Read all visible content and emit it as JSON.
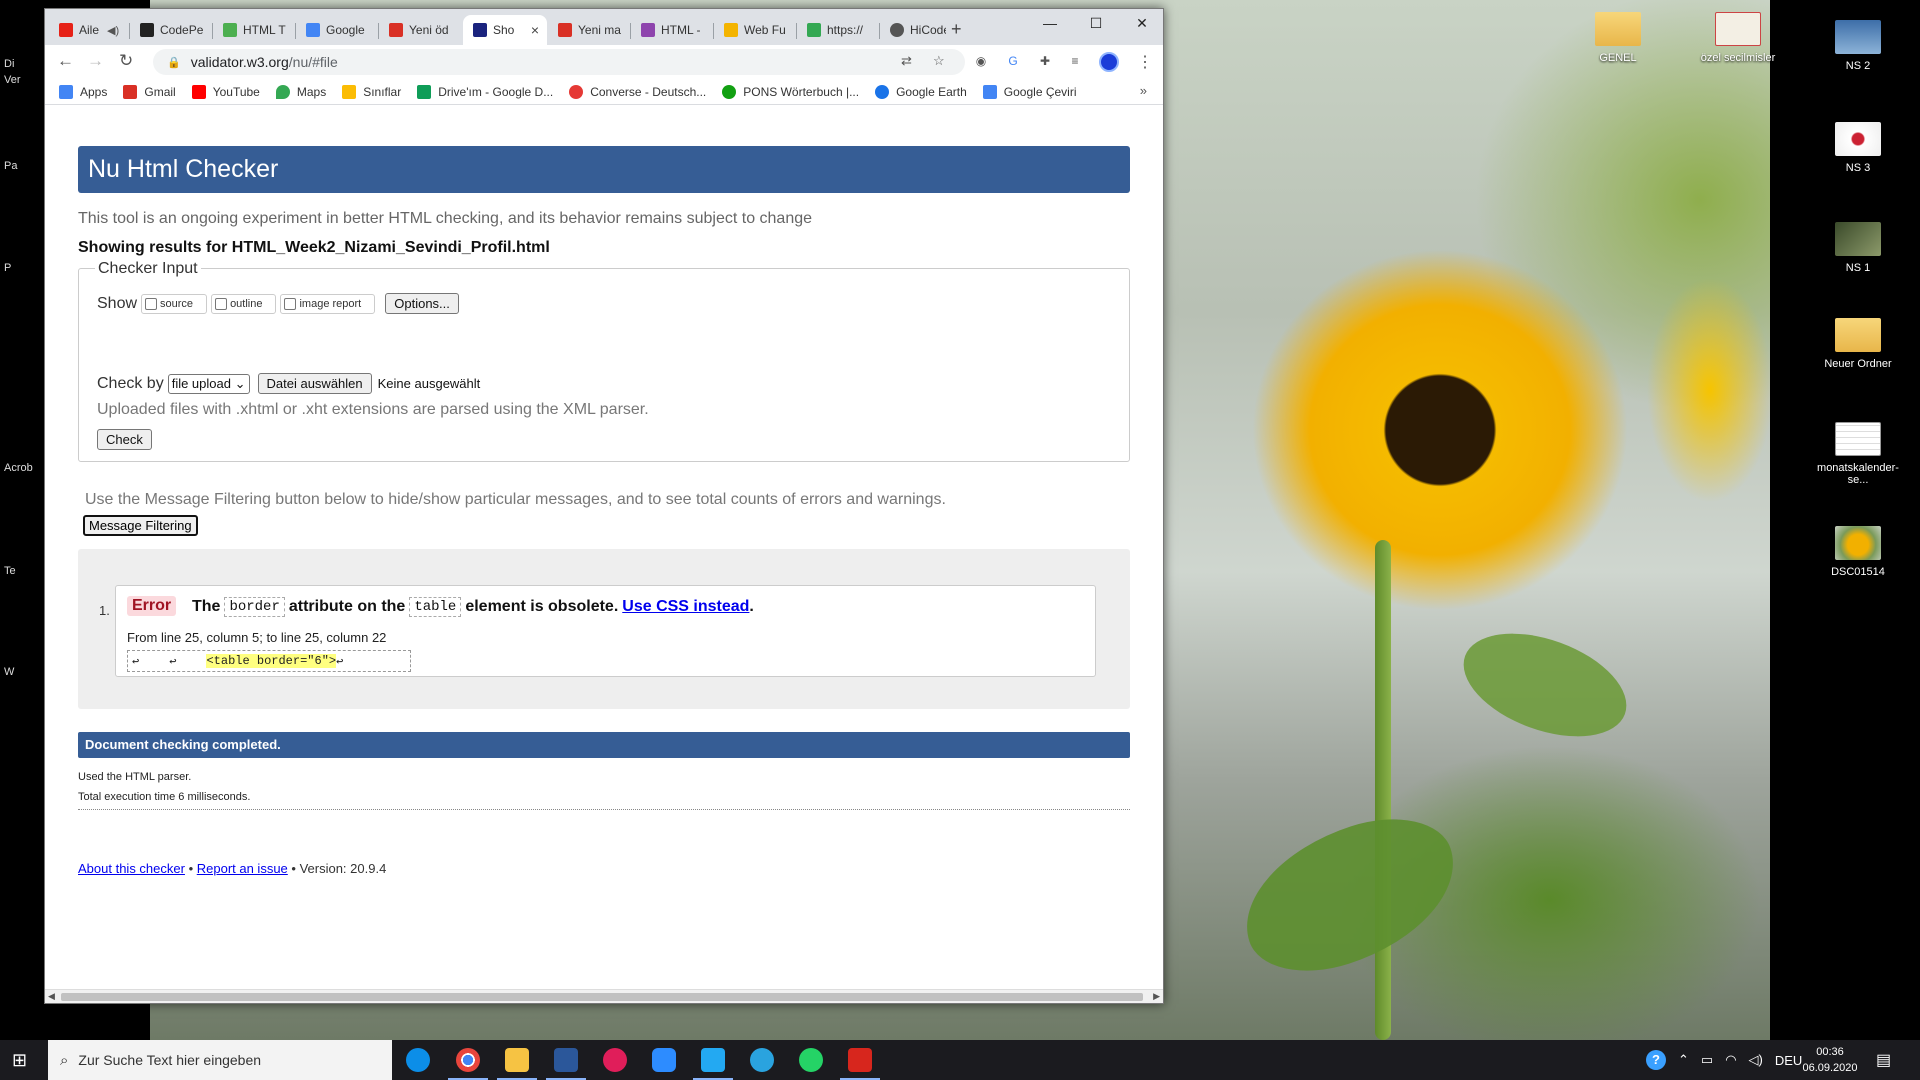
{
  "desktop": {
    "icons": [
      {
        "label": "GENEL",
        "thumb": "thumb-folder"
      },
      {
        "label": "özel secilmisler",
        "thumb": "thumb-pdf"
      },
      {
        "label": "NS 2",
        "thumb": "thumb-img1"
      },
      {
        "label": "NS 3",
        "thumb": "thumb-img2"
      },
      {
        "label": "NS 1",
        "thumb": "thumb-img3"
      },
      {
        "label": "Neuer Ordner",
        "thumb": "thumb-folder"
      },
      {
        "label": "monatskalender-se...",
        "thumb": "thumb-sheet"
      },
      {
        "label": "DSC01514",
        "thumb": "thumb-photo"
      }
    ],
    "left_fragments": [
      "Di",
      "Ver",
      "Pa",
      "P",
      "Acrob",
      "Te",
      "W"
    ]
  },
  "browser": {
    "tabs": [
      {
        "title": "Aile",
        "color": "#e62117"
      },
      {
        "title": "CodePe",
        "color": "#222222"
      },
      {
        "title": "HTML T",
        "color": "#4caf50"
      },
      {
        "title": "Google",
        "color": "#4285f4"
      },
      {
        "title": "Yeni öd",
        "color": "#d93025"
      },
      {
        "title": "Sho",
        "color": "#1a237e"
      },
      {
        "title": "Yeni ma",
        "color": "#d93025"
      },
      {
        "title": "HTML -",
        "color": "#8e44ad"
      },
      {
        "title": "Web Fu",
        "color": "#f4b400"
      },
      {
        "title": "https://",
        "color": "#34a853"
      },
      {
        "title": "HiCode",
        "color": "#555555"
      }
    ],
    "active_tab_index": 5,
    "tab_close_glyph": "×",
    "new_tab_glyph": "+",
    "window_controls": {
      "minimize": "—",
      "maximize": "☐",
      "close": "✕"
    },
    "nav": {
      "back": "←",
      "forward": "→",
      "reload": "↻"
    },
    "url": {
      "host": "validator.w3.org",
      "path": "/nu/#file"
    },
    "bookmarks": [
      {
        "label": "Apps",
        "color": "#4285f4"
      },
      {
        "label": "Gmail",
        "color": "#d93025"
      },
      {
        "label": "YouTube",
        "color": "#ff0000"
      },
      {
        "label": "Maps",
        "color": "#34a853"
      },
      {
        "label": "Sınıflar",
        "color": "#fbbc04"
      },
      {
        "label": "Drive'ım - Google D...",
        "color": "#0f9d58"
      },
      {
        "label": "Converse - Deutsch...",
        "color": "#e53935"
      },
      {
        "label": "PONS Wörterbuch |...",
        "color": "#12a012"
      },
      {
        "label": "Google Earth",
        "color": "#1a73e8"
      },
      {
        "label": "Google Çeviri",
        "color": "#4285f4"
      }
    ],
    "bookmarks_more": "»"
  },
  "page": {
    "header": "Nu Html Checker",
    "intro": "This tool is an ongoing experiment in better HTML checking, and its behavior remains subject to change",
    "results_prefix": "Showing results for ",
    "results_file": "HTML_Week2_Nizami_Sevindi_Profil.html",
    "checker_input_legend": "Checker Input",
    "show_label": "Show",
    "show_options": [
      "source",
      "outline",
      "image report"
    ],
    "options_button": "Options...",
    "check_by_label": "Check by",
    "check_by_value": "file upload",
    "file_button": "Datei auswählen",
    "no_file": "Keine ausgewählt",
    "xhtml_note": "Uploaded files with .xhtml or .xht extensions are parsed using the XML parser.",
    "check_button": "Check",
    "filter_note": "Use the Message Filtering button below to hide/show particular messages, and to see total counts of errors and warnings.",
    "filter_button": "Message Filtering",
    "message": {
      "number": "1.",
      "type": "Error",
      "text_the": "The",
      "attr": "border",
      "text_attr_on": "attribute on the",
      "element": "table",
      "text_obsolete": "element is obsolete.",
      "link": "Use CSS instead",
      "period": ".",
      "location": "From line 25, column 5; to line 25, column 22",
      "extract_lead": "↩",
      "extract_mid": "↩",
      "extract_code": "<table border=\"6\">",
      "extract_tail": "↩"
    },
    "completed": "Document checking completed.",
    "parser_line": "Used the HTML parser.",
    "exec_line": "Total execution time 6 milliseconds.",
    "footer": {
      "about": "About this checker",
      "sep1": " • ",
      "report": "Report an issue",
      "version": " • Version: 20.9.4"
    }
  },
  "taskbar": {
    "search_placeholder": "Zur Suche Text hier eingeben",
    "apps": [
      {
        "name": "edge",
        "color": "#0c8ee8"
      },
      {
        "name": "chrome",
        "color": "#e8453c"
      },
      {
        "name": "file-explorer",
        "color": "#f6c343"
      },
      {
        "name": "word",
        "color": "#2b579a"
      },
      {
        "name": "slack",
        "color": "#e01e5a"
      },
      {
        "name": "zoom",
        "color": "#2d8cff"
      },
      {
        "name": "vscode",
        "color": "#23a9f2"
      },
      {
        "name": "telegram",
        "color": "#2aa3df"
      },
      {
        "name": "whatsapp",
        "color": "#25d366"
      },
      {
        "name": "acrobat",
        "color": "#d7261d"
      }
    ],
    "language": "DEU",
    "time": "00:36",
    "date": "06.09.2020"
  }
}
